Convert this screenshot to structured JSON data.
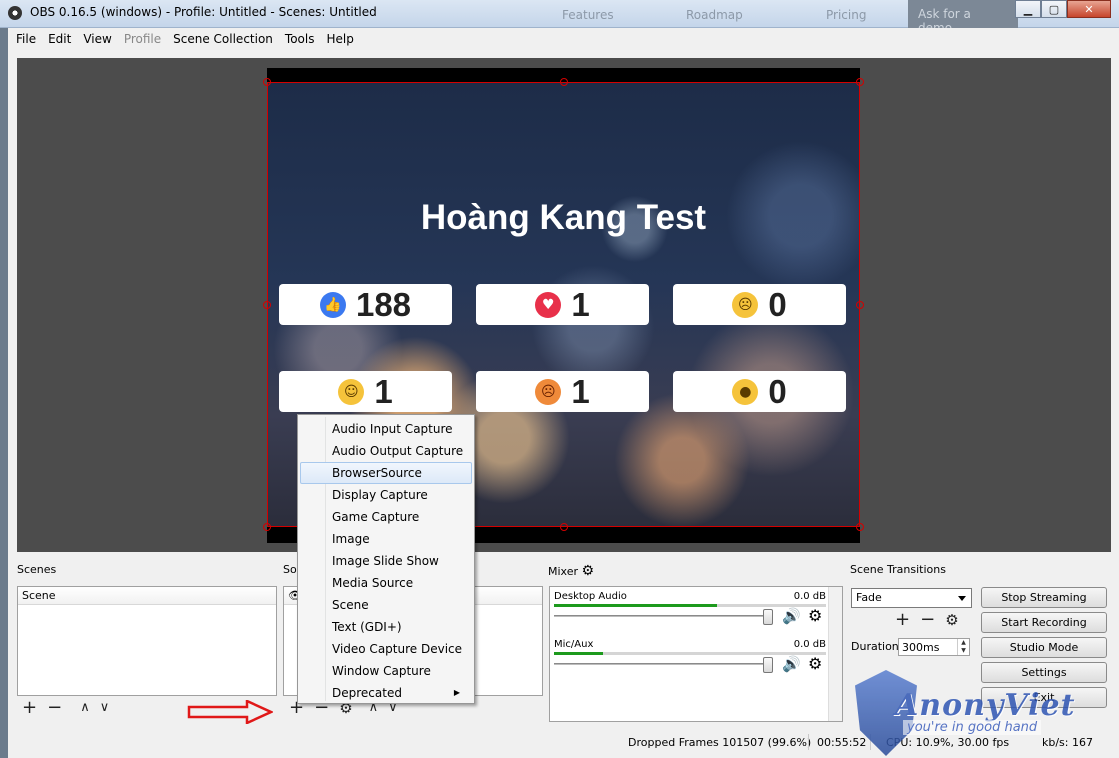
{
  "window": {
    "title": "OBS 0.16.5 (windows) - Profile: Untitled - Scenes: Untitled",
    "bg_tabs": [
      "Features",
      "Roadmap",
      "Pricing",
      "Ask for a demo"
    ]
  },
  "menu": [
    "File",
    "Edit",
    "View",
    "Profile",
    "Scene Collection",
    "Tools",
    "Help"
  ],
  "preview": {
    "heading": "Hoàng Kang Test",
    "reactions": [
      {
        "icon": "like-icon",
        "count": "188",
        "color": "#3b79f0"
      },
      {
        "icon": "love-icon",
        "count": "1",
        "color": "#e8304a"
      },
      {
        "icon": "sad-icon",
        "count": "0",
        "color": "#f5c33b"
      },
      {
        "icon": "haha-icon",
        "count": "1",
        "color": "#f5c33b"
      },
      {
        "icon": "angry-icon",
        "count": "1",
        "color": "#ef8a3a"
      },
      {
        "icon": "wow-icon",
        "count": "0",
        "color": "#f5c33b"
      }
    ]
  },
  "scenes": {
    "label": "Scenes",
    "items": [
      "Scene"
    ]
  },
  "sources": {
    "label": "Sou"
  },
  "context_menu": {
    "items": [
      "Audio Input Capture",
      "Audio Output Capture",
      "BrowserSource",
      "Display Capture",
      "Game Capture",
      "Image",
      "Image Slide Show",
      "Media Source",
      "Scene",
      "Text (GDI+)",
      "Video Capture Device",
      "Window Capture",
      "Deprecated"
    ],
    "highlighted": "BrowserSource"
  },
  "mixer": {
    "label": "Mixer",
    "channels": [
      {
        "name": "Desktop Audio",
        "db": "0.0 dB",
        "level": 0.6
      },
      {
        "name": "Mic/Aux",
        "db": "0.0 dB",
        "level": 0.18
      }
    ]
  },
  "transitions": {
    "label": "Scene Transitions",
    "selected": "Fade",
    "duration_label": "Duration",
    "duration_value": "300ms"
  },
  "controls": {
    "stop_streaming": "Stop Streaming",
    "start_recording": "Start Recording",
    "studio_mode": "Studio Mode",
    "settings": "Settings",
    "exit_partial": "Exit"
  },
  "status": {
    "dropped_frames": "Dropped Frames 101507 (99.6%)",
    "time": "00:55:52",
    "cpu": "CPU: 10.9%, 30.00 fps",
    "kbps": "kb/s: 167"
  },
  "watermark": {
    "brand": "AnonyViet",
    "tagline": "you're in good hand"
  }
}
